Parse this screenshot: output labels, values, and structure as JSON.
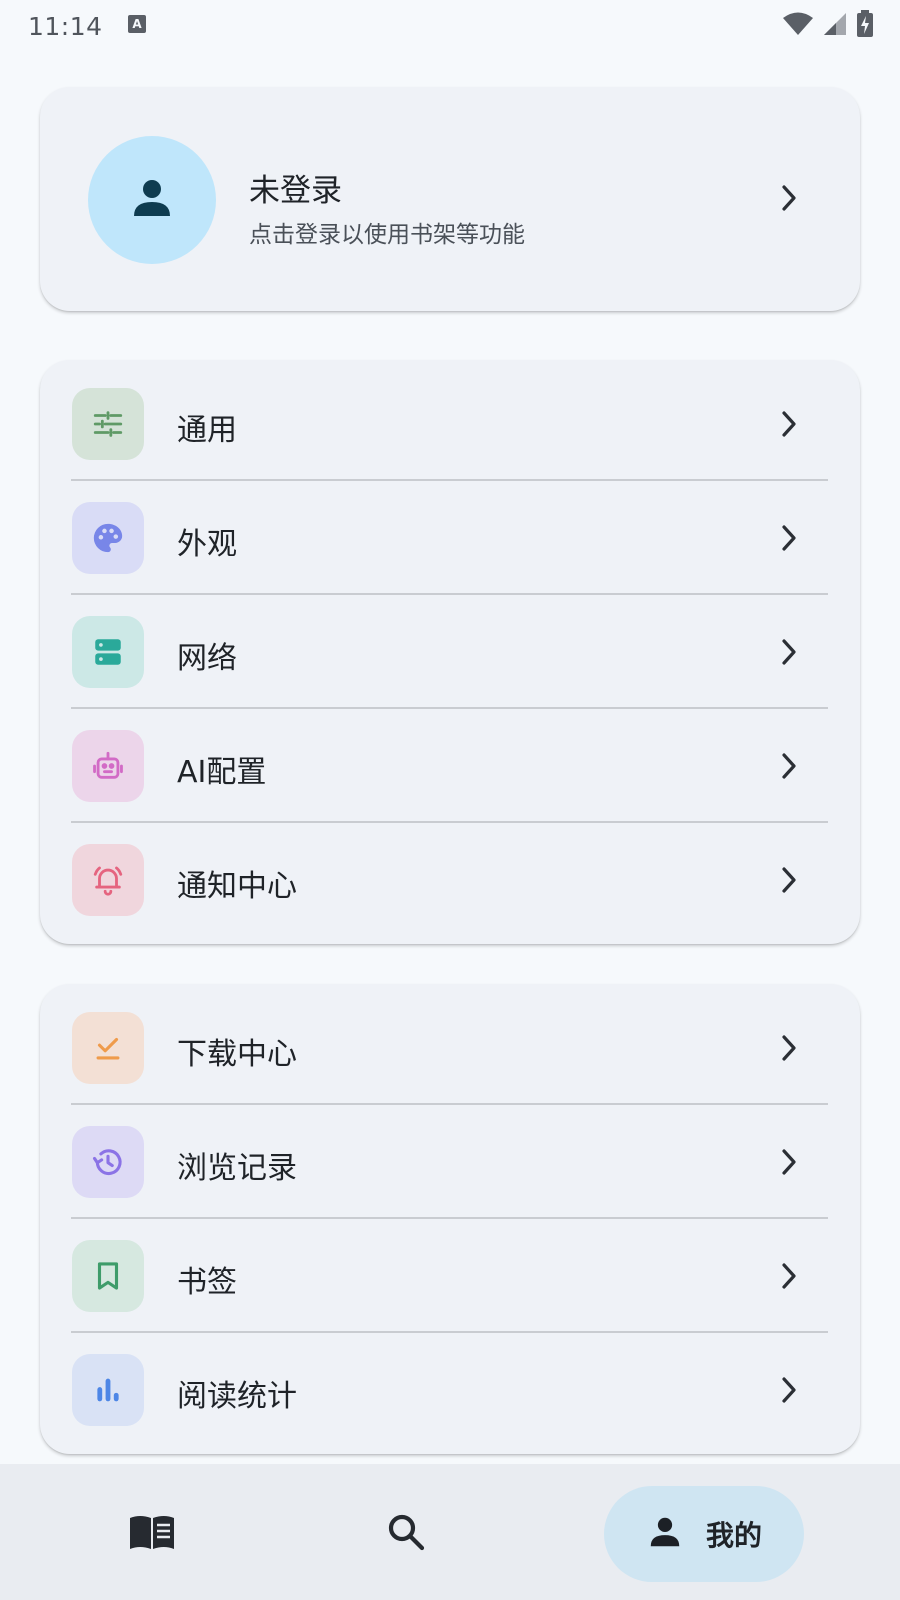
{
  "status_bar": {
    "time": "11:14",
    "icons": [
      "keyboard-indicator-icon",
      "wifi-icon",
      "signal-icon",
      "battery-charging-icon"
    ]
  },
  "profile": {
    "name": "未登录",
    "subtitle": "点击登录以使用书架等功能",
    "avatar_icon": "person-icon"
  },
  "settings_group": [
    {
      "label": "通用",
      "icon": "tune-icon",
      "icon_bg": "#d5e3d8",
      "icon_color": "#5f9a66"
    },
    {
      "label": "外观",
      "icon": "palette-icon",
      "icon_bg": "#d9dcf6",
      "icon_color": "#7886e8"
    },
    {
      "label": "网络",
      "icon": "dns-icon",
      "icon_bg": "#cce8e6",
      "icon_color": "#2aa99a"
    },
    {
      "label": "AI配置",
      "icon": "robot-icon",
      "icon_bg": "#ecd5ea",
      "icon_color": "#d26bc6"
    },
    {
      "label": "通知中心",
      "icon": "bell-ringing-icon",
      "icon_bg": "#f0d6dd",
      "icon_color": "#e5647f"
    }
  ],
  "library_group": [
    {
      "label": "下载中心",
      "icon": "download-done-icon",
      "icon_bg": "#f3e0d5",
      "icon_color": "#ef9b4b"
    },
    {
      "label": "浏览记录",
      "icon": "history-icon",
      "icon_bg": "#dddaf5",
      "icon_color": "#8b73e6"
    },
    {
      "label": "书签",
      "icon": "bookmark-icon",
      "icon_bg": "#d6e8e0",
      "icon_color": "#3e9c6a"
    },
    {
      "label": "阅读统计",
      "icon": "bar-chart-icon",
      "icon_bg": "#d9e2f5",
      "icon_color": "#4d86e6"
    }
  ],
  "bottom_nav": {
    "items": [
      {
        "icon": "book-open-icon",
        "label": ""
      },
      {
        "icon": "search-icon",
        "label": ""
      },
      {
        "icon": "person-icon",
        "label": "我的",
        "selected": true
      }
    ]
  }
}
